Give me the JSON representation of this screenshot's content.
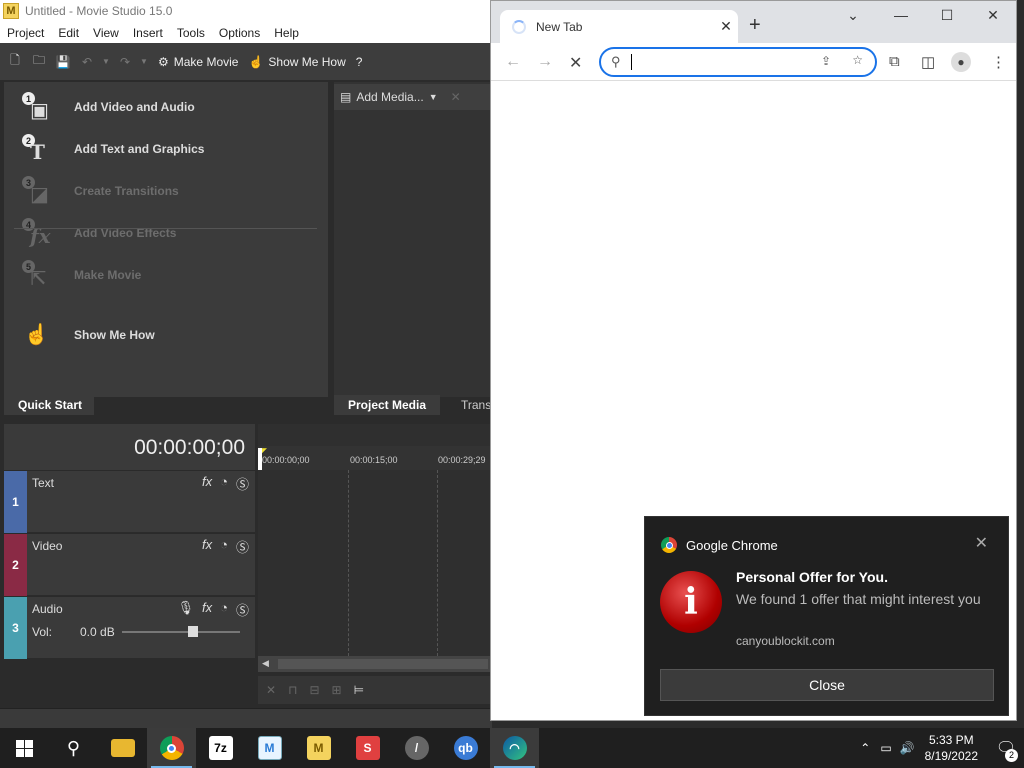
{
  "movie_studio": {
    "title": "Untitled - Movie Studio 15.0",
    "logo_letter": "M",
    "menu": [
      "Project",
      "Edit",
      "View",
      "Insert",
      "Tools",
      "Options",
      "Help"
    ],
    "toolbar": {
      "make_movie": "Make Movie",
      "show_me_how": "Show Me How"
    },
    "quick_start": {
      "items": [
        {
          "num": "1",
          "label": "Add Video and Audio",
          "enabled": true
        },
        {
          "num": "2",
          "label": "Add Text and Graphics",
          "enabled": true
        },
        {
          "num": "3",
          "label": "Create Transitions",
          "enabled": false
        },
        {
          "num": "4",
          "label": "Add Video Effects",
          "enabled": false
        },
        {
          "num": "5",
          "label": "Make Movie",
          "enabled": false
        }
      ],
      "show_me_how": "Show Me How",
      "tab_label": "Quick Start"
    },
    "project_media": {
      "add_media": "Add Media...",
      "tab_label": "Project Media",
      "tab2_label": "Transitions"
    },
    "timecode": "00:00:00;00",
    "ruler": [
      "00:00:00;00",
      "00:00:15;00",
      "00:00:29;29"
    ],
    "tracks": [
      {
        "num": "1",
        "name": "Text",
        "color": "#4a6aa8"
      },
      {
        "num": "2",
        "name": "Video",
        "color": "#8a2a45"
      },
      {
        "num": "3",
        "name": "Audio",
        "color": "#4aa0b0",
        "vol_label": "Vol:",
        "vol_value": "0.0 dB"
      }
    ]
  },
  "chrome": {
    "tab_title": "New Tab",
    "notification": {
      "app": "Google Chrome",
      "title": "Personal Offer for You.",
      "body": "We found 1 offer that might interest you",
      "source": "canyoublockit.com",
      "button": "Close"
    }
  },
  "taskbar": {
    "apps": [
      {
        "name": "start",
        "label": "Start"
      },
      {
        "name": "search",
        "label": "Search"
      },
      {
        "name": "file-explorer",
        "label": "File Explorer"
      },
      {
        "name": "chrome",
        "label": "Chrome",
        "active": true
      },
      {
        "name": "7zip",
        "label": "7z"
      },
      {
        "name": "app-m-blue",
        "label": "M"
      },
      {
        "name": "app-m-yellow",
        "label": "M"
      },
      {
        "name": "app-s",
        "label": "S"
      },
      {
        "name": "app-pen",
        "label": "Pen"
      },
      {
        "name": "qbittorrent",
        "label": "qb"
      },
      {
        "name": "app-edge",
        "label": "Edge",
        "active": true
      }
    ],
    "time": "5:33 PM",
    "date": "8/19/2022",
    "notification_count": "2"
  }
}
